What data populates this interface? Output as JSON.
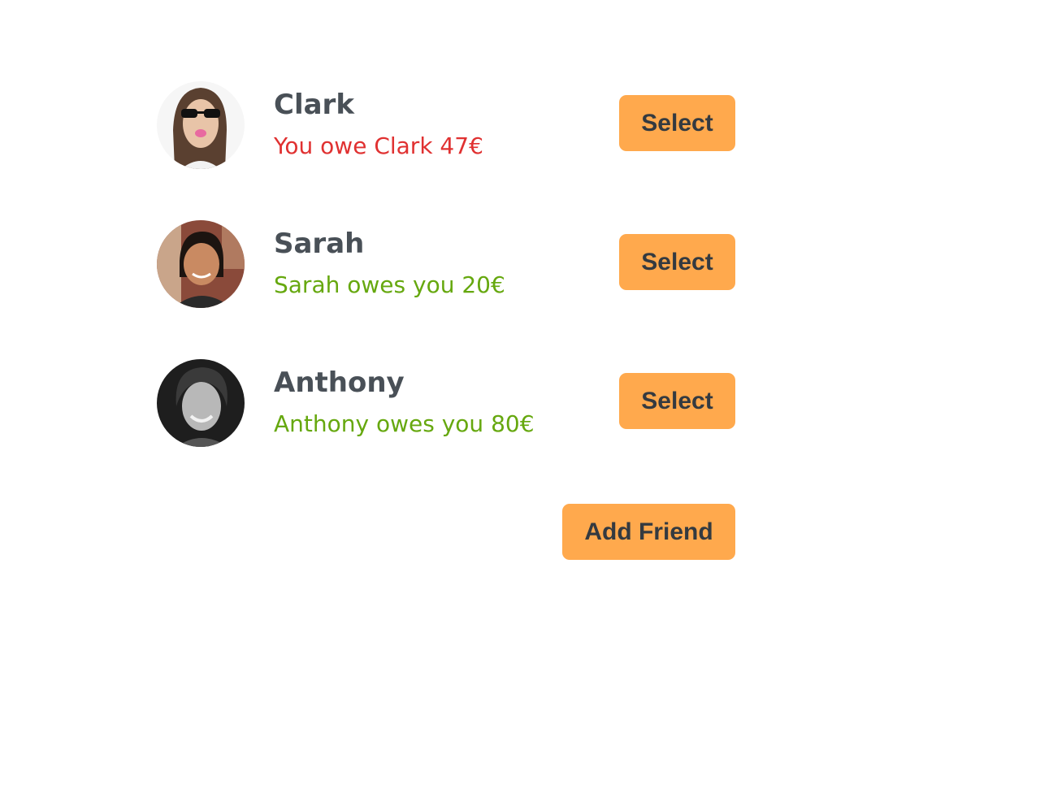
{
  "friends": [
    {
      "name": "Clark",
      "balance": "You owe Clark 47€",
      "status": "owe",
      "select_label": "Select"
    },
    {
      "name": "Sarah",
      "balance": "Sarah owes you 20€",
      "status": "owed",
      "select_label": "Select"
    },
    {
      "name": "Anthony",
      "balance": "Anthony owes you 80€",
      "status": "owed",
      "select_label": "Select"
    }
  ],
  "actions": {
    "add_friend_label": "Add Friend"
  },
  "colors": {
    "accent": "#ffa94d",
    "owe": "#e03131",
    "owed": "#66a80f",
    "text": "#495057"
  }
}
